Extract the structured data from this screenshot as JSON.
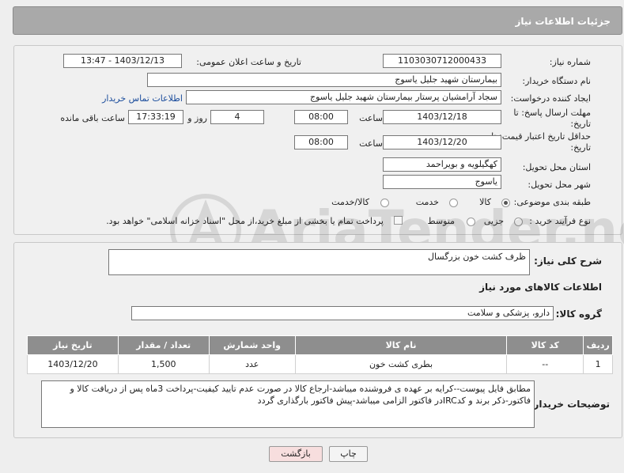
{
  "header": {
    "title": "جزئیات اطلاعات نیاز"
  },
  "form": {
    "need_number_label": "شماره نیاز:",
    "need_number": "1103030712000433",
    "announce_label": "تاریخ و ساعت اعلان عمومی:",
    "announce_value": "1403/12/13 - 13:47",
    "buyer_org_label": "نام دستگاه خریدار:",
    "buyer_org": "بیمارستان شهید جلیل یاسوج",
    "creator_label": "ایجاد کننده درخواست:",
    "creator": "سجاد آرامشیان پرستار بیمارستان شهید جلیل یاسوج",
    "contact_link": "اطلاعات تماس خریدار",
    "deadline_label_line1": "مهلت ارسال پاسخ: تا",
    "deadline_label_line2": "تاریخ:",
    "deadline_date": "1403/12/18",
    "time_label": "ساعت",
    "deadline_time": "08:00",
    "days_value": "4",
    "days_label": "روز و",
    "remaining_time": "17:33:19",
    "remaining_label": "ساعت باقی مانده",
    "validity_label_line1": "حداقل تاریخ اعتبار قیمت: تا",
    "validity_label_line2": "تاریخ:",
    "validity_date": "1403/12/20",
    "validity_time": "08:00",
    "province_label": "استان محل تحویل:",
    "province": "کهگیلویه و بویراحمد",
    "city_label": "شهر محل تحویل:",
    "city": "یاسوج",
    "category_label": "طبقه بندی موضوعی:",
    "category_options": [
      "کالا",
      "خدمت",
      "کالا/خدمت"
    ],
    "category_selected": "کالا",
    "process_label": "نوع فرآیند خرید :",
    "process_options": [
      "جزیی",
      "متوسط"
    ],
    "process_note": "پرداخت تمام یا بخشی از مبلغ خرید،از محل \"اسناد خزانه اسلامی\" خواهد بود."
  },
  "details": {
    "summary_label": "شرح کلی نیاز:",
    "summary": "ظرف کشت خون بزرگسال",
    "goods_info_title": "اطلاعات کالاهای مورد نیاز",
    "goods_group_label": "گروه کالا:",
    "goods_group": "دارو، پزشکی و سلامت",
    "table": {
      "headers": [
        "ردیف",
        "کد کالا",
        "نام کالا",
        "واحد شمارش",
        "تعداد / مقدار",
        "تاریخ نیاز"
      ],
      "rows": [
        [
          "1",
          "--",
          "بطری کشت خون",
          "عدد",
          "1,500",
          "1403/12/20"
        ]
      ]
    },
    "buyer_notes_label": "توضیحات خریدار:",
    "buyer_notes": "مطابق فایل پیوست--کرایه بر عهده ی فروشنده میباشد-ارجاع کالا در صورت عدم تایید کیفیت-پرداخت 3ماه پس از دریافت کالا و فاکتور-ذکر برند و کدIRCدر فاکتور الزامی میباشد-پیش فاکتور بارگذاری گردد"
  },
  "buttons": {
    "print": "چاپ",
    "back": "بازگشت"
  },
  "watermark": {
    "text": "AriaTender.net"
  },
  "colors": {
    "header_bg": "#a9a9a9",
    "table_header_bg": "#8e8e8e",
    "back_button_bg": "#f7dede",
    "link": "#1a4c9c"
  }
}
